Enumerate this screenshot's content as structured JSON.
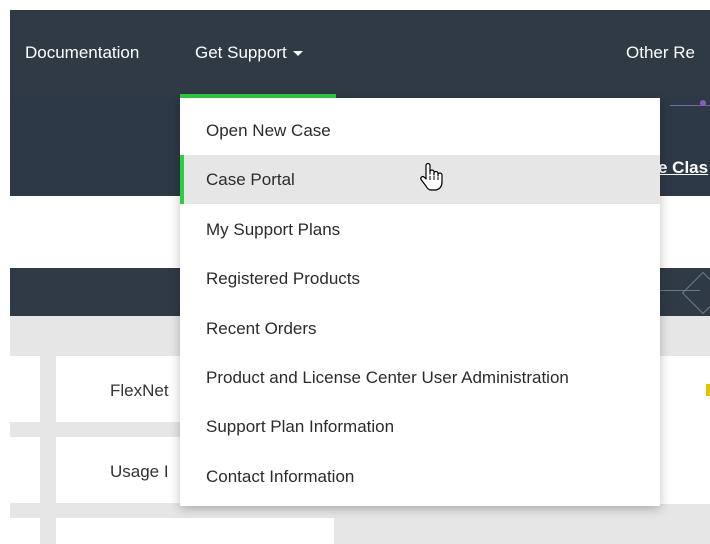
{
  "nav": {
    "documentation": "Documentation",
    "get_support": "Get Support",
    "other_resources": "Other Re"
  },
  "band2": {
    "link_text": "e Clas"
  },
  "grid": {
    "cell_a": "FlexNet",
    "cell_b": "Usage I"
  },
  "dropdown": {
    "items": [
      {
        "label": "Open New Case"
      },
      {
        "label": "Case Portal",
        "active": true
      },
      {
        "label": "My Support Plans"
      },
      {
        "label": "Registered Products"
      },
      {
        "label": "Recent Orders"
      },
      {
        "label": "Product and License Center User Administration"
      },
      {
        "label": "Support Plan Information"
      },
      {
        "label": "Contact Information"
      }
    ]
  },
  "colors": {
    "nav_bg": "#2f3a45",
    "accent": "#2ecc40",
    "menu_hover": "#e6e6e6"
  },
  "icons": {
    "cursor": "hand-pointer-icon",
    "caret": "caret-down-icon"
  }
}
